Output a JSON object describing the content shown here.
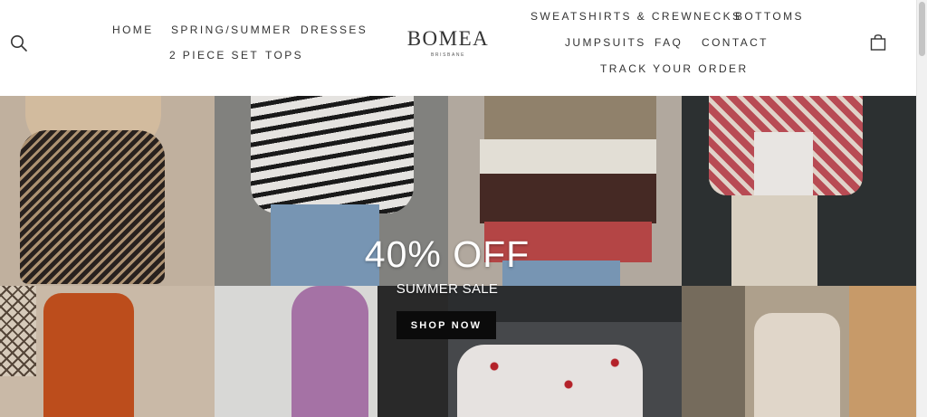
{
  "nav": {
    "left": [
      {
        "label": "HOME"
      },
      {
        "label": "SPRING/SUMMER"
      },
      {
        "label": "DRESSES"
      },
      {
        "label": "2 PIECE SET"
      },
      {
        "label": "TOPS"
      }
    ],
    "right": [
      {
        "label": "SWEATSHIRTS & CREWNECKS"
      },
      {
        "label": "BOTTOMS"
      },
      {
        "label": "JUMPSUITS"
      },
      {
        "label": "FAQ"
      },
      {
        "label": "CONTACT"
      },
      {
        "label": "TRACK YOUR ORDER"
      }
    ]
  },
  "logo": {
    "name": "BOMEA",
    "tagline": "BRISBANE"
  },
  "hero": {
    "title": "40% OFF",
    "subtitle": "SUMMER SALE",
    "cta_label": "SHOP NOW"
  },
  "icons": {
    "search": "search-icon",
    "cart": "shopping-bag-icon"
  },
  "colors": {
    "cta_background": "#0b0b0b",
    "hero_text": "#ffffff",
    "nav_text": "#333333"
  }
}
